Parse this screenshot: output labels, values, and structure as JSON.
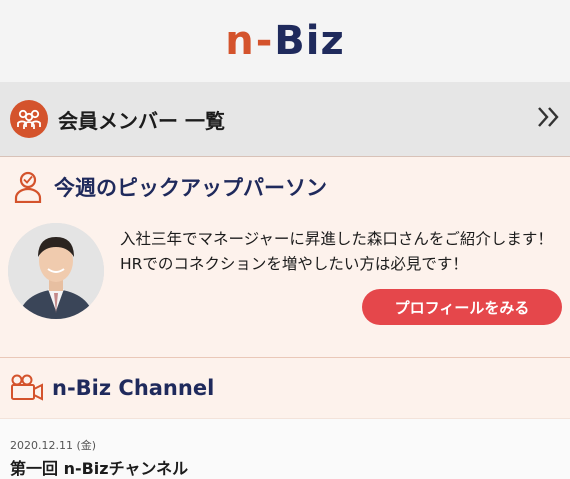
{
  "logo": {
    "part1": "n",
    "part2": "-",
    "part3": "Biz"
  },
  "members": {
    "title": "会員メンバー 一覧",
    "chevron": "››"
  },
  "pickup": {
    "title": "今週のピックアップパーソン",
    "description": "入社三年でマネージャーに昇進した森口さんをご紹介します！HRでのコネクションを増やしたい方は必見です！",
    "button": "プロフィールをみる"
  },
  "channel": {
    "title": "n-Biz Channel"
  },
  "news": {
    "date": "2020.12.11 (金)",
    "title": "第一回 n-Bizチャンネル"
  },
  "colors": {
    "accent": "#d4532c",
    "navy": "#1f2a5c",
    "button": "#e5474b"
  },
  "icons": [
    "people-group-icon",
    "person-icon",
    "camera-icon",
    "double-chevron-right-icon"
  ]
}
